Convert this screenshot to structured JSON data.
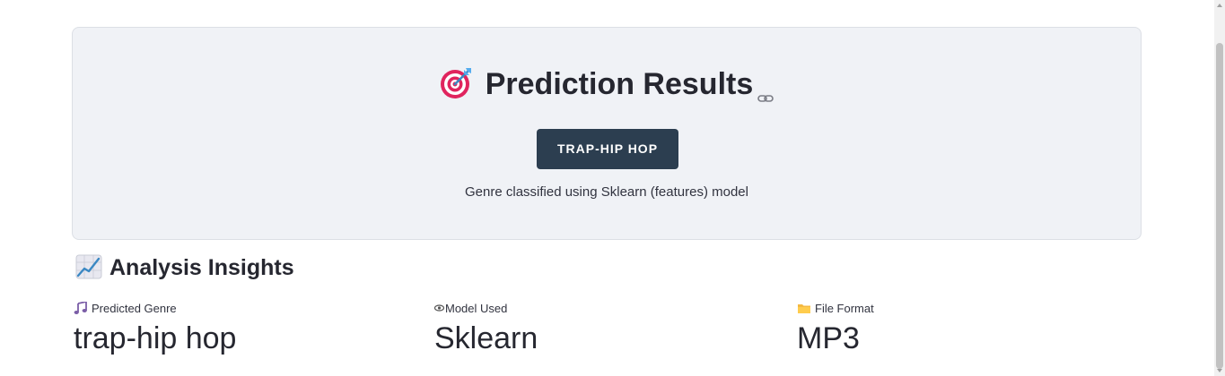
{
  "result": {
    "title": "Prediction Results",
    "title_icon": "target-icon",
    "link_icon": "link-icon",
    "genre_badge": "TRAP-HIP HOP",
    "caption": "Genre classified using Sklearn (features) model"
  },
  "insights": {
    "header": "Analysis Insights",
    "header_icon": "chart-increasing-icon",
    "metrics": [
      {
        "icon": "music-note-icon",
        "label": "Predicted Genre",
        "value": "trap-hip hop"
      },
      {
        "icon": "eye-icon",
        "label": "Model Used",
        "value": "Sklearn"
      },
      {
        "icon": "folder-icon",
        "label": "File Format",
        "value": "MP3"
      }
    ]
  },
  "colors": {
    "card_background": "#f0f2f6",
    "badge_background": "#2c3e50",
    "badge_text": "#ffffff",
    "text": "#31333f"
  }
}
